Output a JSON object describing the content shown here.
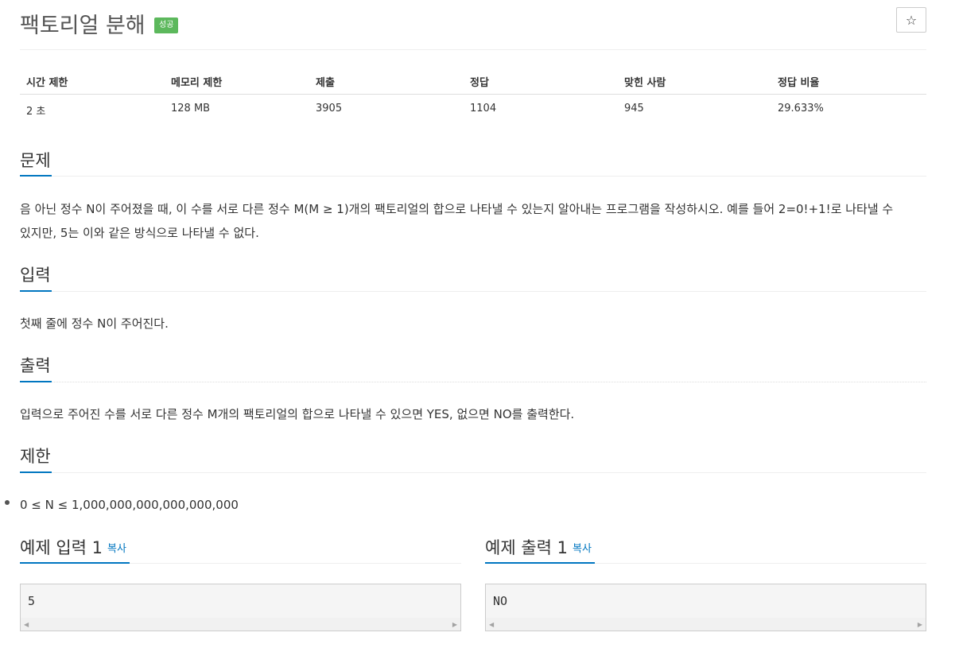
{
  "problem": {
    "title": "팩토리얼 분해",
    "badge": "성공",
    "star_icon": "☆"
  },
  "info": {
    "headers": [
      "시간 제한",
      "메모리 제한",
      "제출",
      "정답",
      "맞힌 사람",
      "정답 비율"
    ],
    "values": [
      "2 초",
      "128 MB",
      "3905",
      "1104",
      "945",
      "29.633%"
    ]
  },
  "sections": {
    "description": {
      "title": "문제",
      "text_line1": "음 아닌 정수 N이 주어졌을 때, 이 수를 서로 다른 정수 M(M ≥ 1)개의 팩토리얼의 합으로 나타낼 수 있는지 알아내는 프로그램을 작성하시오. 예를 들어 2=0!+1!로 나타낼 수",
      "text_line2": "있지만, 5는 이와 같은 방식으로 나타낼 수 없다."
    },
    "input": {
      "title": "입력",
      "text": "첫째 줄에 정수 N이 주어진다."
    },
    "output": {
      "title": "출력",
      "text": "입력으로 주어진 수를 서로 다른 정수 M개의 팩토리얼의 합으로 나타낼 수 있으면 YES, 없으면 NO를 출력한다."
    },
    "limit": {
      "title": "제한",
      "item": "0 ≤ N ≤ 1,000,000,000,000,000,000"
    }
  },
  "samples": {
    "input": {
      "title": "예제 입력 1",
      "copy": "복사",
      "value": "5"
    },
    "output": {
      "title": "예제 출력 1",
      "copy": "복사",
      "value": "NO"
    }
  },
  "colors": {
    "accent": "#0076c0",
    "badge": "#5cb85c"
  }
}
